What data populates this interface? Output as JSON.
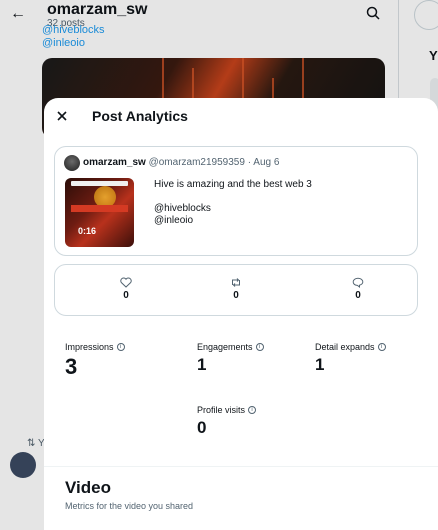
{
  "background": {
    "profile_name": "omarzam_sw",
    "posts_count": "32 posts",
    "link_1": "@hiveblocks",
    "link_2": "@inleoio",
    "side_heading": "Y",
    "retweet_label": "Y"
  },
  "modal": {
    "title": "Post Analytics",
    "post": {
      "author_name": "omarzam_sw",
      "author_handle": "@omarzam21959359",
      "separator": "·",
      "date": "Aug 6",
      "video_duration": "0:16",
      "text_lines": [
        "Hive is amazing and the best web 3",
        "",
        "@hiveblocks",
        "@inleoio"
      ]
    },
    "engagement": {
      "likes": "0",
      "reposts": "0",
      "replies": "0"
    },
    "metrics": {
      "impressions": {
        "label": "Impressions",
        "value": "3"
      },
      "engagements": {
        "label": "Engagements",
        "value": "1"
      },
      "detail_expands": {
        "label": "Detail expands",
        "value": "1"
      },
      "profile_visits": {
        "label": "Profile visits",
        "value": "0"
      }
    },
    "video_section": {
      "title": "Video",
      "subtitle": "Metrics for the video you shared"
    }
  },
  "icons": [
    "back-arrow-icon",
    "search-icon",
    "close-icon",
    "heart-icon",
    "repost-icon",
    "reply-icon",
    "info-icon"
  ],
  "colors": {
    "link": "#1d9bf0",
    "text": "#0f1419",
    "muted": "#536471",
    "border": "#cfd9de"
  }
}
